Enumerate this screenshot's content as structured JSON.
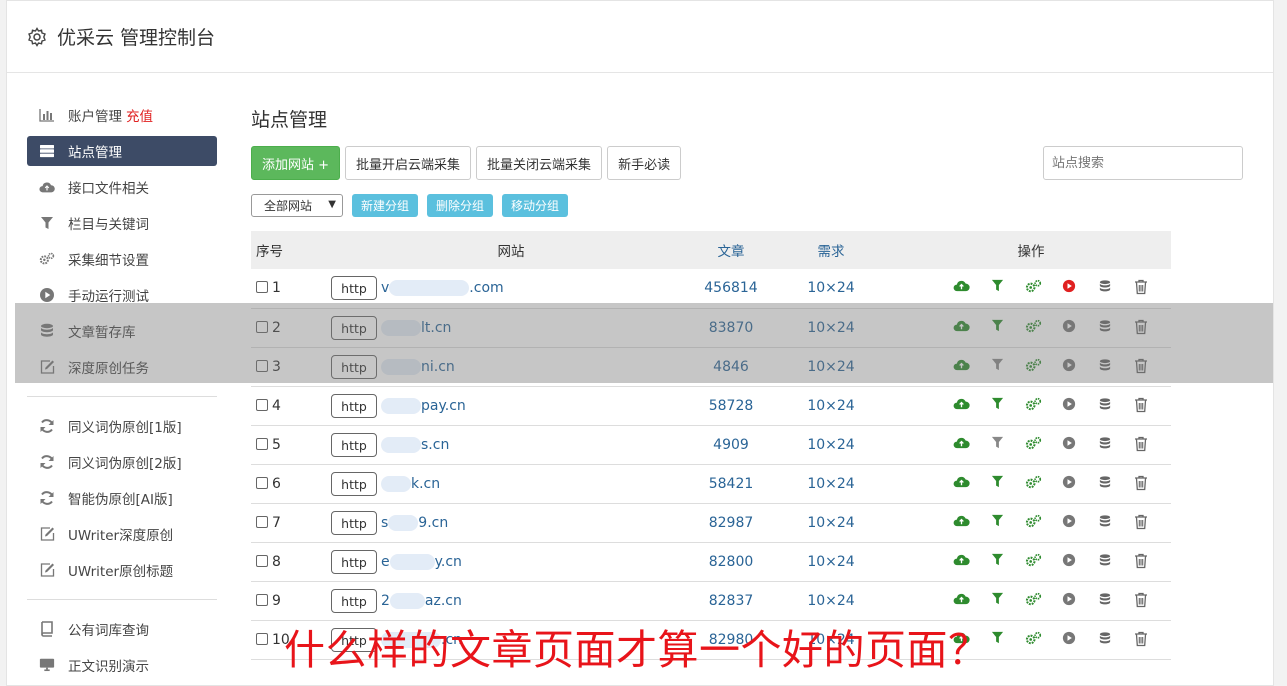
{
  "header": {
    "title": "优采云 管理控制台",
    "icon": "gear-icon"
  },
  "sidebar": {
    "items": [
      {
        "label": "账户管理",
        "extra": "充值",
        "icon": "bar-chart-icon"
      },
      {
        "label": "站点管理",
        "icon": "server-icon",
        "active": true
      },
      {
        "label": "接口文件相关",
        "icon": "cloud-upload-icon"
      },
      {
        "label": "栏目与关键词",
        "icon": "filter-icon"
      },
      {
        "label": "采集细节设置",
        "icon": "cogs-icon"
      },
      {
        "label": "手动运行测试",
        "icon": "play-circle-icon"
      },
      {
        "label": "文章暂存库",
        "icon": "database-icon"
      },
      {
        "label": "深度原创任务",
        "icon": "edit-icon"
      }
    ],
    "items2": [
      {
        "label": "同义词伪原创[1版]",
        "icon": "refresh-icon"
      },
      {
        "label": "同义词伪原创[2版]",
        "icon": "refresh-icon"
      },
      {
        "label": "智能伪原创[AI版]",
        "icon": "refresh-icon"
      },
      {
        "label": "UWriter深度原创",
        "icon": "edit-icon"
      },
      {
        "label": "UWriter原创标题",
        "icon": "edit-icon"
      }
    ],
    "items3": [
      {
        "label": "公有词库查询",
        "icon": "book-icon"
      },
      {
        "label": "正文识别演示",
        "icon": "monitor-icon"
      }
    ]
  },
  "main": {
    "title": "站点管理",
    "toolbar": {
      "add_site": "添加网站 +",
      "batch_open": "批量开启云端采集",
      "batch_close": "批量关闭云端采集",
      "newbie": "新手必读",
      "search_placeholder": "站点搜索"
    },
    "filter": {
      "select_value": "全部网站",
      "new_group": "新建分组",
      "delete_group": "删除分组",
      "move_group": "移动分组"
    },
    "table": {
      "headers": [
        "序号",
        "网站",
        "文章",
        "需求",
        "操作"
      ],
      "rows": [
        {
          "no": "1",
          "prefix": "http",
          "lead": "v",
          "site": ".com",
          "articles": "456814",
          "req": "10×24",
          "play_active": true,
          "filter_green": true
        },
        {
          "no": "2",
          "prefix": "http",
          "lead": "",
          "site": "lt.cn",
          "articles": "83870",
          "req": "10×24",
          "play_active": false,
          "filter_green": true
        },
        {
          "no": "3",
          "prefix": "http",
          "lead": "",
          "site": "ni.cn",
          "articles": "4846",
          "req": "10×24",
          "play_active": false,
          "filter_green": false
        },
        {
          "no": "4",
          "prefix": "http",
          "lead": "",
          "site": "pay.cn",
          "articles": "58728",
          "req": "10×24",
          "play_active": false,
          "filter_green": true
        },
        {
          "no": "5",
          "prefix": "http",
          "lead": "",
          "site": "s.cn",
          "articles": "4909",
          "req": "10×24",
          "play_active": false,
          "filter_green": false
        },
        {
          "no": "6",
          "prefix": "http",
          "lead": "",
          "site": "k.cn",
          "articles": "58421",
          "req": "10×24",
          "play_active": false,
          "filter_green": true
        },
        {
          "no": "7",
          "prefix": "http",
          "lead": "s",
          "site": "9.cn",
          "articles": "82987",
          "req": "10×24",
          "play_active": false,
          "filter_green": true
        },
        {
          "no": "8",
          "prefix": "http",
          "lead": "e",
          "site": "y.cn",
          "articles": "82800",
          "req": "10×24",
          "play_active": false,
          "filter_green": true
        },
        {
          "no": "9",
          "prefix": "http",
          "lead": "2",
          "site": "az.cn",
          "articles": "82837",
          "req": "10×24",
          "play_active": false,
          "filter_green": true
        },
        {
          "no": "10",
          "prefix": "http",
          "lead": "",
          "site": ".cn",
          "articles": "82980",
          "req": "10×24",
          "play_active": false,
          "filter_green": true
        }
      ]
    }
  },
  "caption": "什么样的文章页面才算一个好的页面？",
  "colors": {
    "nav_active": "#3d4b66",
    "green": "#5cb85c",
    "info": "#5bc0de",
    "link": "#2a6496",
    "caption": "#e8141a"
  }
}
